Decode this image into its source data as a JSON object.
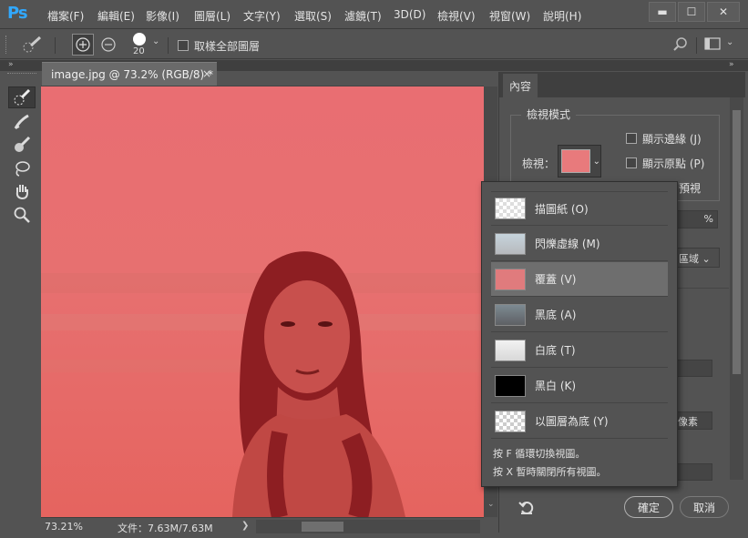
{
  "app": {
    "logo": "Ps"
  },
  "menu": [
    "檔案(F)",
    "編輯(E)",
    "影像(I)",
    "圖層(L)",
    "文字(Y)",
    "選取(S)",
    "濾鏡(T)",
    "3D(D)",
    "檢視(V)",
    "視窗(W)",
    "說明(H)"
  ],
  "window_controls": {
    "minimize": "▬",
    "maximize": "☐",
    "close": "✕"
  },
  "options": {
    "brush_size": "20",
    "sample_all_layers": "取樣全部圖層"
  },
  "document": {
    "tab_title": "image.jpg @ 73.2% (RGB/8) *",
    "tab_close": "×",
    "zoom": "73.21%",
    "file_info": "文件：7.63M/7.63M",
    "status_arrow": "❯"
  },
  "panel": {
    "tab": "內容",
    "view_mode_title": "檢視模式",
    "view_label": "檢視：",
    "show_edge": "顯示邊緣 (J)",
    "show_original": "顯示原點 (P)",
    "partial_preview": "預視",
    "percent_suffix": "%",
    "region_suffix": "區域",
    "pixel_suffix": "像素",
    "ok": "確定",
    "cancel": "取消"
  },
  "dropdown": {
    "items": [
      {
        "label": "描圖紙 (O)",
        "thumb": "onion"
      },
      {
        "label": "閃爍虛線 (M)",
        "thumb": "marching"
      },
      {
        "label": "覆蓋 (V)",
        "thumb": "overlay",
        "selected": true
      },
      {
        "label": "黑底 (A)",
        "thumb": "black-bg"
      },
      {
        "label": "白底 (T)",
        "thumb": "white-bg"
      },
      {
        "label": "黑白 (K)",
        "thumb": "bw"
      },
      {
        "label": "以圖層為底 (Y)",
        "thumb": "layers"
      }
    ],
    "hint1": "按 F 循環切換視圖。",
    "hint2": "按 X 暫時關閉所有視圖。"
  },
  "colors": {
    "overlay_red": "#e86d6f",
    "ui_bg": "#535353",
    "selected_row": "#6e6e6e"
  }
}
